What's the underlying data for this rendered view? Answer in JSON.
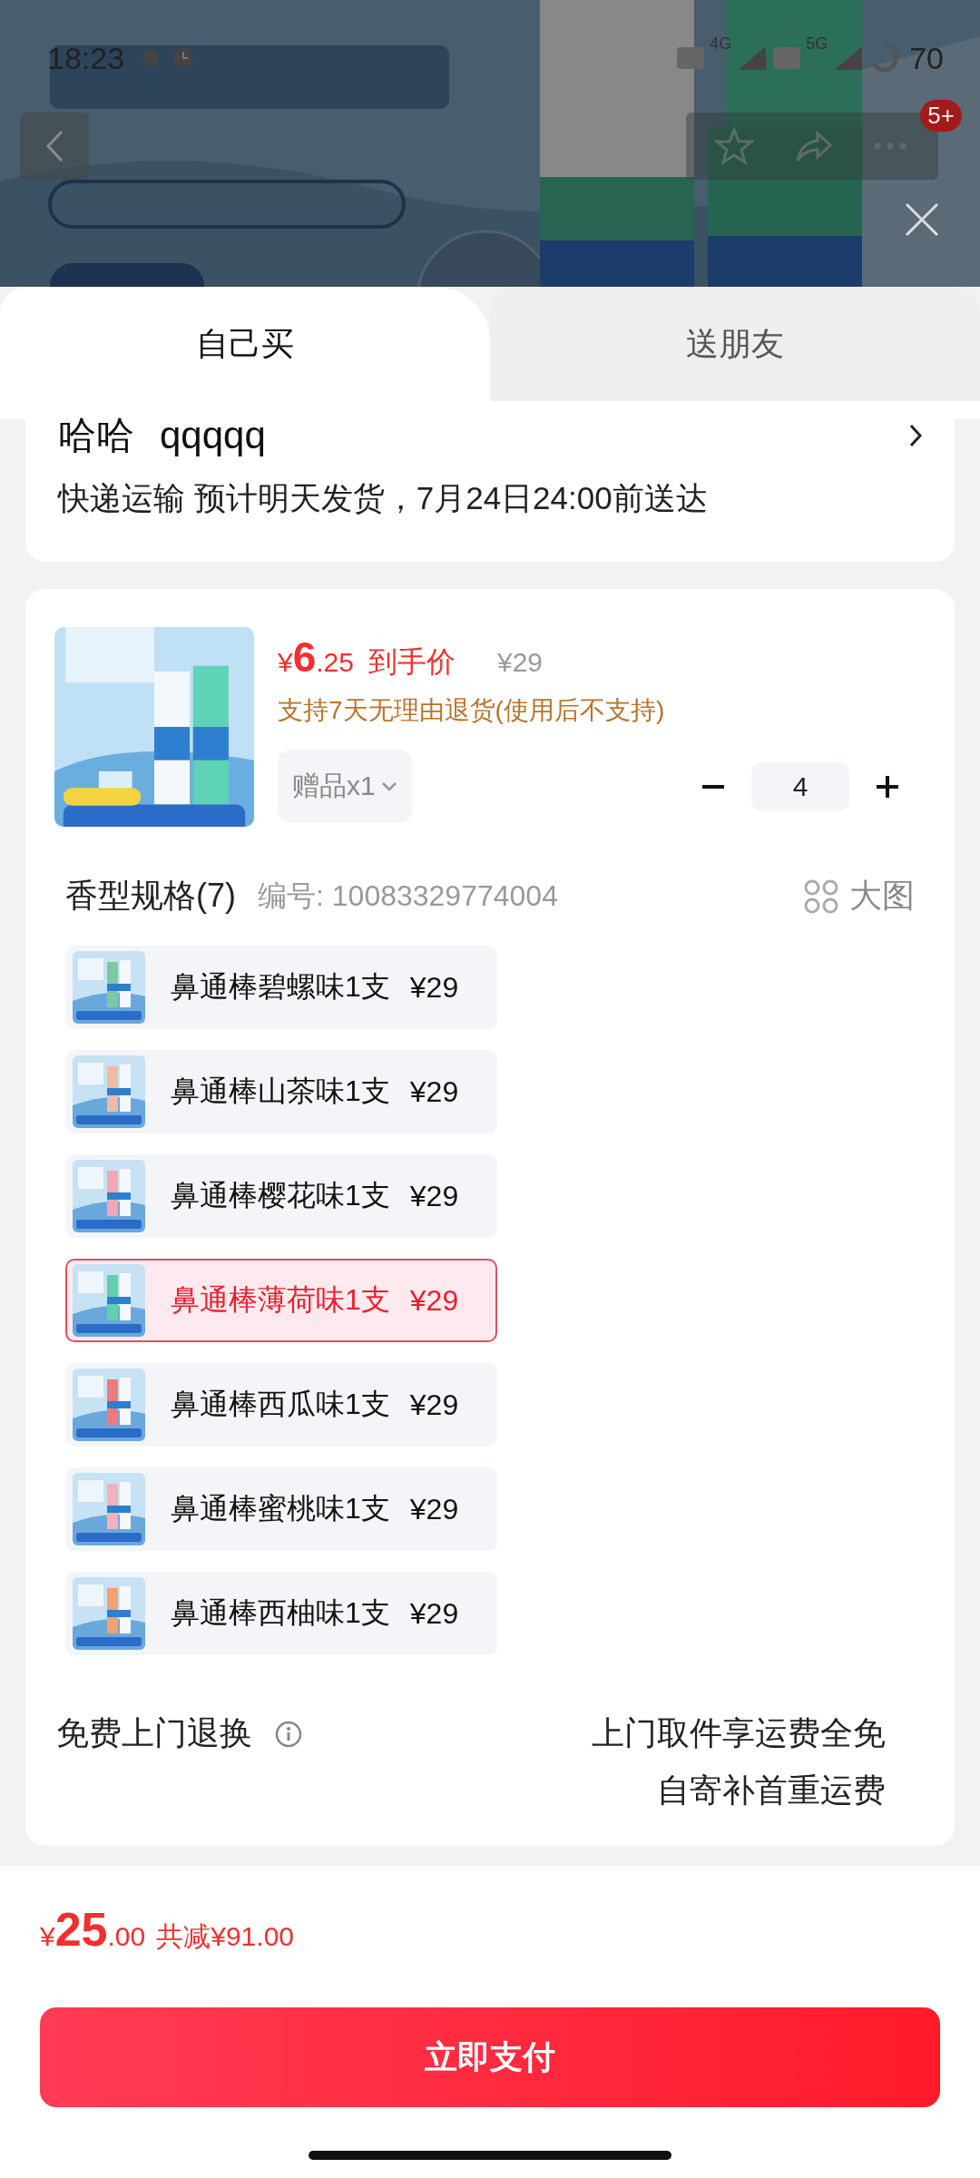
{
  "status_bar": {
    "time": "18:23",
    "network_1": "4G",
    "network_2": "5G",
    "battery": "70"
  },
  "top_bar": {
    "badge": "5+"
  },
  "tabs": [
    {
      "label": "自己买",
      "selected": true
    },
    {
      "label": "送朋友",
      "selected": false
    }
  ],
  "address": {
    "name": "哈哈",
    "phone": "qqqqq",
    "delivery": "快递运输 预计明天发货，7月24日24:00前送达"
  },
  "product": {
    "price": {
      "symbol": "¥",
      "integer": "6",
      "decimal": ".25"
    },
    "price_label": "到手价",
    "original_price": "¥29",
    "return_policy": "支持7天无理由退货(使用后不支持)",
    "gift": "赠品x1",
    "quantity": "4"
  },
  "specs": {
    "title": "香型规格(7)",
    "sku": "编号: 10083329774004",
    "view_label": "大图",
    "options": [
      {
        "label": "鼻通棒碧螺味1支",
        "price": "¥29",
        "selected": false
      },
      {
        "label": "鼻通棒山茶味1支",
        "price": "¥29",
        "selected": false
      },
      {
        "label": "鼻通棒樱花味1支",
        "price": "¥29",
        "selected": false
      },
      {
        "label": "鼻通棒薄荷味1支",
        "price": "¥29",
        "selected": true
      },
      {
        "label": "鼻通棒西瓜味1支",
        "price": "¥29",
        "selected": false
      },
      {
        "label": "鼻通棒蜜桃味1支",
        "price": "¥29",
        "selected": false
      },
      {
        "label": "鼻通棒西柚味1支",
        "price": "¥29",
        "selected": false
      }
    ]
  },
  "service": {
    "title": "免费上门退换",
    "line_1": "上门取件享运费全免",
    "line_2": "自寄补首重运费"
  },
  "footer": {
    "total": {
      "symbol": "¥",
      "integer": "25",
      "decimal": ".00"
    },
    "discount": "共减¥91.00",
    "pay_button": "立即支付"
  }
}
